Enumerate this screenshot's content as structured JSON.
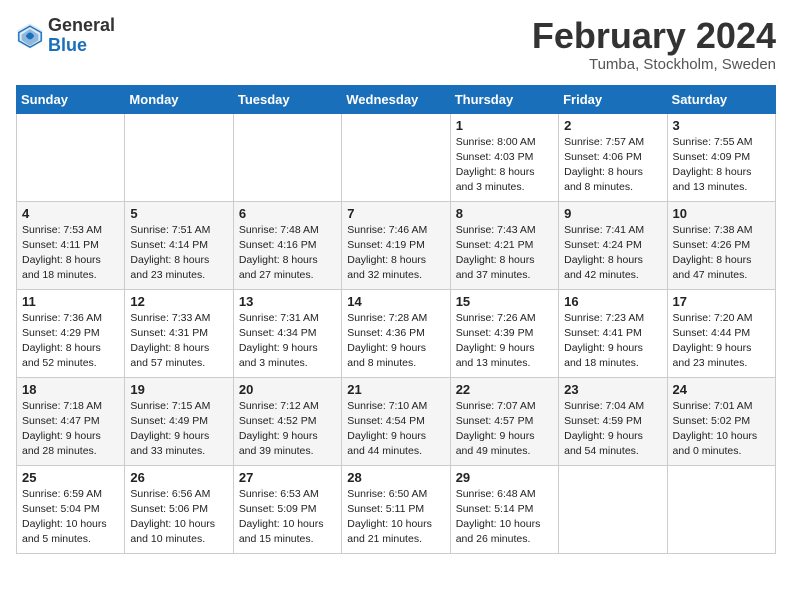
{
  "header": {
    "logo": {
      "general": "General",
      "blue": "Blue"
    },
    "month": "February 2024",
    "location": "Tumba, Stockholm, Sweden"
  },
  "days_of_week": [
    "Sunday",
    "Monday",
    "Tuesday",
    "Wednesday",
    "Thursday",
    "Friday",
    "Saturday"
  ],
  "weeks": [
    [
      {
        "day": "",
        "sunrise": "",
        "sunset": "",
        "daylight": ""
      },
      {
        "day": "",
        "sunrise": "",
        "sunset": "",
        "daylight": ""
      },
      {
        "day": "",
        "sunrise": "",
        "sunset": "",
        "daylight": ""
      },
      {
        "day": "",
        "sunrise": "",
        "sunset": "",
        "daylight": ""
      },
      {
        "day": "1",
        "sunrise": "Sunrise: 8:00 AM",
        "sunset": "Sunset: 4:03 PM",
        "daylight": "Daylight: 8 hours and 3 minutes."
      },
      {
        "day": "2",
        "sunrise": "Sunrise: 7:57 AM",
        "sunset": "Sunset: 4:06 PM",
        "daylight": "Daylight: 8 hours and 8 minutes."
      },
      {
        "day": "3",
        "sunrise": "Sunrise: 7:55 AM",
        "sunset": "Sunset: 4:09 PM",
        "daylight": "Daylight: 8 hours and 13 minutes."
      }
    ],
    [
      {
        "day": "4",
        "sunrise": "Sunrise: 7:53 AM",
        "sunset": "Sunset: 4:11 PM",
        "daylight": "Daylight: 8 hours and 18 minutes."
      },
      {
        "day": "5",
        "sunrise": "Sunrise: 7:51 AM",
        "sunset": "Sunset: 4:14 PM",
        "daylight": "Daylight: 8 hours and 23 minutes."
      },
      {
        "day": "6",
        "sunrise": "Sunrise: 7:48 AM",
        "sunset": "Sunset: 4:16 PM",
        "daylight": "Daylight: 8 hours and 27 minutes."
      },
      {
        "day": "7",
        "sunrise": "Sunrise: 7:46 AM",
        "sunset": "Sunset: 4:19 PM",
        "daylight": "Daylight: 8 hours and 32 minutes."
      },
      {
        "day": "8",
        "sunrise": "Sunrise: 7:43 AM",
        "sunset": "Sunset: 4:21 PM",
        "daylight": "Daylight: 8 hours and 37 minutes."
      },
      {
        "day": "9",
        "sunrise": "Sunrise: 7:41 AM",
        "sunset": "Sunset: 4:24 PM",
        "daylight": "Daylight: 8 hours and 42 minutes."
      },
      {
        "day": "10",
        "sunrise": "Sunrise: 7:38 AM",
        "sunset": "Sunset: 4:26 PM",
        "daylight": "Daylight: 8 hours and 47 minutes."
      }
    ],
    [
      {
        "day": "11",
        "sunrise": "Sunrise: 7:36 AM",
        "sunset": "Sunset: 4:29 PM",
        "daylight": "Daylight: 8 hours and 52 minutes."
      },
      {
        "day": "12",
        "sunrise": "Sunrise: 7:33 AM",
        "sunset": "Sunset: 4:31 PM",
        "daylight": "Daylight: 8 hours and 57 minutes."
      },
      {
        "day": "13",
        "sunrise": "Sunrise: 7:31 AM",
        "sunset": "Sunset: 4:34 PM",
        "daylight": "Daylight: 9 hours and 3 minutes."
      },
      {
        "day": "14",
        "sunrise": "Sunrise: 7:28 AM",
        "sunset": "Sunset: 4:36 PM",
        "daylight": "Daylight: 9 hours and 8 minutes."
      },
      {
        "day": "15",
        "sunrise": "Sunrise: 7:26 AM",
        "sunset": "Sunset: 4:39 PM",
        "daylight": "Daylight: 9 hours and 13 minutes."
      },
      {
        "day": "16",
        "sunrise": "Sunrise: 7:23 AM",
        "sunset": "Sunset: 4:41 PM",
        "daylight": "Daylight: 9 hours and 18 minutes."
      },
      {
        "day": "17",
        "sunrise": "Sunrise: 7:20 AM",
        "sunset": "Sunset: 4:44 PM",
        "daylight": "Daylight: 9 hours and 23 minutes."
      }
    ],
    [
      {
        "day": "18",
        "sunrise": "Sunrise: 7:18 AM",
        "sunset": "Sunset: 4:47 PM",
        "daylight": "Daylight: 9 hours and 28 minutes."
      },
      {
        "day": "19",
        "sunrise": "Sunrise: 7:15 AM",
        "sunset": "Sunset: 4:49 PM",
        "daylight": "Daylight: 9 hours and 33 minutes."
      },
      {
        "day": "20",
        "sunrise": "Sunrise: 7:12 AM",
        "sunset": "Sunset: 4:52 PM",
        "daylight": "Daylight: 9 hours and 39 minutes."
      },
      {
        "day": "21",
        "sunrise": "Sunrise: 7:10 AM",
        "sunset": "Sunset: 4:54 PM",
        "daylight": "Daylight: 9 hours and 44 minutes."
      },
      {
        "day": "22",
        "sunrise": "Sunrise: 7:07 AM",
        "sunset": "Sunset: 4:57 PM",
        "daylight": "Daylight: 9 hours and 49 minutes."
      },
      {
        "day": "23",
        "sunrise": "Sunrise: 7:04 AM",
        "sunset": "Sunset: 4:59 PM",
        "daylight": "Daylight: 9 hours and 54 minutes."
      },
      {
        "day": "24",
        "sunrise": "Sunrise: 7:01 AM",
        "sunset": "Sunset: 5:02 PM",
        "daylight": "Daylight: 10 hours and 0 minutes."
      }
    ],
    [
      {
        "day": "25",
        "sunrise": "Sunrise: 6:59 AM",
        "sunset": "Sunset: 5:04 PM",
        "daylight": "Daylight: 10 hours and 5 minutes."
      },
      {
        "day": "26",
        "sunrise": "Sunrise: 6:56 AM",
        "sunset": "Sunset: 5:06 PM",
        "daylight": "Daylight: 10 hours and 10 minutes."
      },
      {
        "day": "27",
        "sunrise": "Sunrise: 6:53 AM",
        "sunset": "Sunset: 5:09 PM",
        "daylight": "Daylight: 10 hours and 15 minutes."
      },
      {
        "day": "28",
        "sunrise": "Sunrise: 6:50 AM",
        "sunset": "Sunset: 5:11 PM",
        "daylight": "Daylight: 10 hours and 21 minutes."
      },
      {
        "day": "29",
        "sunrise": "Sunrise: 6:48 AM",
        "sunset": "Sunset: 5:14 PM",
        "daylight": "Daylight: 10 hours and 26 minutes."
      },
      {
        "day": "",
        "sunrise": "",
        "sunset": "",
        "daylight": ""
      },
      {
        "day": "",
        "sunrise": "",
        "sunset": "",
        "daylight": ""
      }
    ]
  ]
}
